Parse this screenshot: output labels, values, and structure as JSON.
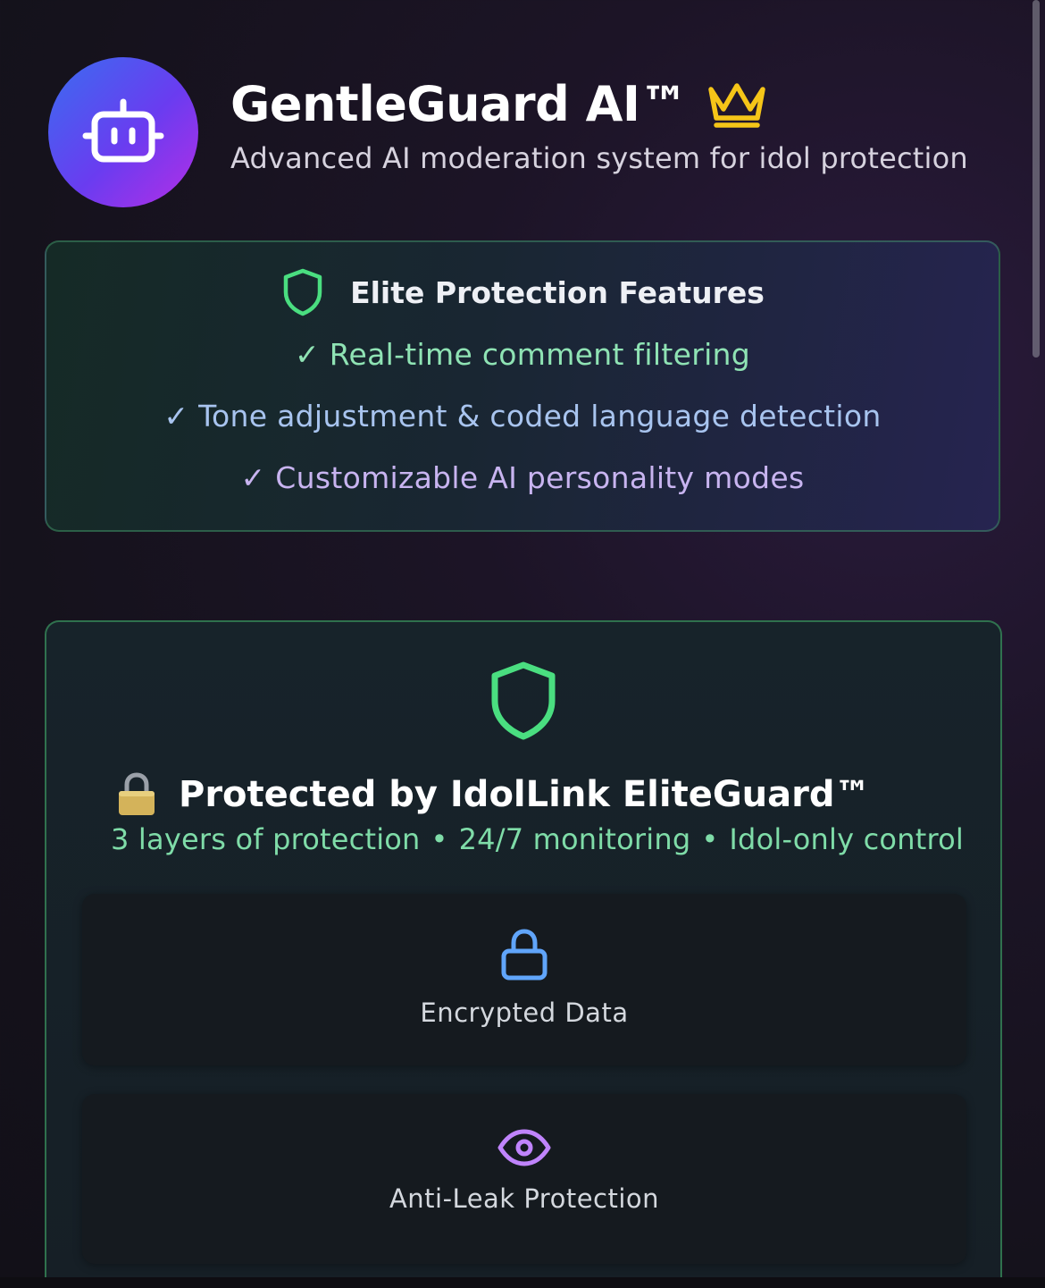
{
  "header": {
    "title": "GentleGuard AI™",
    "subtitle": "Advanced AI moderation system for idol protection",
    "avatar_icon": "robot-icon",
    "badge_icon": "crown-icon"
  },
  "features": {
    "title": "Elite Protection Features",
    "icon": "shield-icon",
    "items": [
      "✓ Real-time comment filtering",
      "✓ Tone adjustment & coded language detection",
      "✓ Customizable AI personality modes"
    ]
  },
  "guard": {
    "icon": "shield-icon",
    "title_emoji": "padlock-icon",
    "title": "Protected by IdolLink EliteGuard™",
    "subtitle_parts": [
      "3 layers of protection",
      "24/7 monitoring",
      "Idol-only control"
    ],
    "separator": "•",
    "items": [
      {
        "label": "Encrypted Data",
        "icon": "lock-icon"
      },
      {
        "label": "Anti-Leak Protection",
        "icon": "eye-icon"
      }
    ]
  },
  "colors": {
    "accent_green": "#4ade80",
    "accent_blue": "#60a5fa",
    "accent_purple": "#c084fc",
    "crown_gold": "#f5c518"
  }
}
